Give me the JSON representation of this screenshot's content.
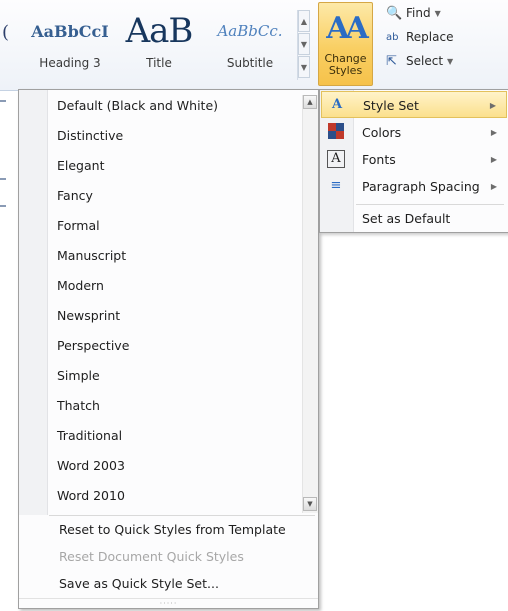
{
  "ribbon": {
    "gallery_edge_glyph": "(",
    "quick_styles": [
      {
        "sample": "AaBbCcI",
        "label": "Heading 3"
      },
      {
        "sample": "AaB",
        "label": "Title"
      },
      {
        "sample": "AaBbCc.",
        "label": "Subtitle"
      }
    ],
    "change_styles_label": "Change Styles",
    "change_styles_glyph": "AA",
    "editing": {
      "find_label": "Find",
      "replace_label": "Replace",
      "select_label": "Select"
    }
  },
  "style_set_menu": {
    "items": [
      "Default (Black and White)",
      "Distinctive",
      "Elegant",
      "Fancy",
      "Formal",
      "Manuscript",
      "Modern",
      "Newsprint",
      "Perspective",
      "Simple",
      "Thatch",
      "Traditional",
      "Word 2003",
      "Word 2010"
    ],
    "commands": [
      {
        "label": "Reset to Quick Styles from Template",
        "enabled": true
      },
      {
        "label": "Reset Document Quick Styles",
        "enabled": false
      },
      {
        "label": "Save as Quick Style Set...",
        "enabled": true
      }
    ],
    "grip": "·····"
  },
  "change_styles_menu": {
    "items": [
      {
        "label": "Style Set",
        "icon": "style-set-icon",
        "submenu": true,
        "highlighted": true
      },
      {
        "label": "Colors",
        "icon": "colors-icon",
        "submenu": true
      },
      {
        "label": "Fonts",
        "icon": "fonts-icon",
        "submenu": true
      },
      {
        "label": "Paragraph Spacing",
        "icon": "paragraph-spacing-icon",
        "submenu": true
      },
      {
        "label": "Set as Default",
        "icon": "",
        "submenu": false
      }
    ]
  },
  "colors": {
    "highlight": "#fbe08d",
    "menu_background": "#fcfcfd",
    "accent_blue": "#365f91"
  }
}
